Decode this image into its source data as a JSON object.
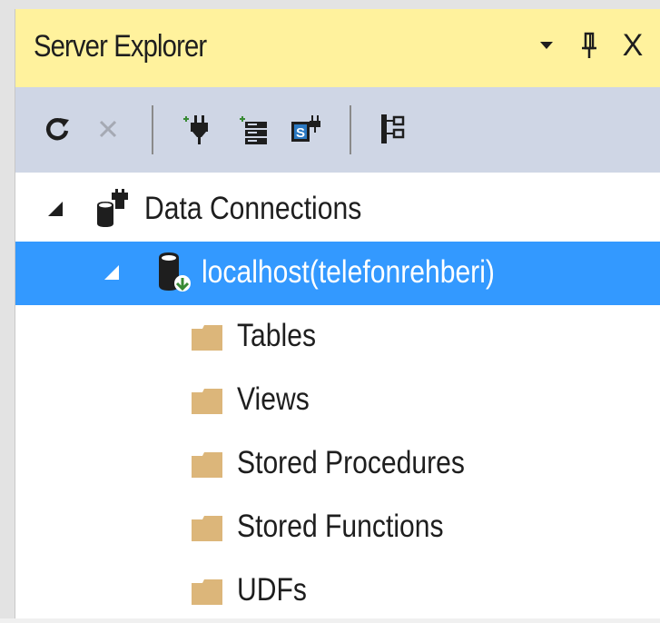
{
  "window": {
    "title": "Server Explorer",
    "dropdown_icon": "triangle-down-icon",
    "pin_icon": "pin-icon",
    "close_glyph": "X"
  },
  "toolbar": {
    "buttons": [
      {
        "name": "refresh",
        "icon": "refresh-icon",
        "enabled": true
      },
      {
        "name": "stop",
        "icon": "close-icon",
        "enabled": false
      },
      {
        "name": "connect-to-database",
        "icon": "plug-add-icon",
        "enabled": true
      },
      {
        "name": "connect-to-server",
        "icon": "server-add-icon",
        "enabled": true
      },
      {
        "name": "connect-to-sharepoint",
        "icon": "sharepoint-icon",
        "enabled": true
      },
      {
        "name": "filter",
        "icon": "tree-view-icon",
        "enabled": true
      }
    ]
  },
  "tree": {
    "root": {
      "label": "Data Connections",
      "expanded": true,
      "icon": "data-connections-icon"
    },
    "connection": {
      "label": "localhost(telefonrehberi)",
      "expanded": true,
      "selected": true,
      "icon": "database-icon"
    },
    "children": [
      {
        "label": "Tables",
        "icon": "folder-icon"
      },
      {
        "label": "Views",
        "icon": "folder-icon"
      },
      {
        "label": "Stored Procedures",
        "icon": "folder-icon"
      },
      {
        "label": "Stored Functions",
        "icon": "folder-icon"
      },
      {
        "label": "UDFs",
        "icon": "folder-icon"
      }
    ]
  },
  "colors": {
    "title_bar": "#fff29d",
    "toolbar": "#cfd6e5",
    "selection": "#3399ff",
    "folder": "#dcb67a"
  }
}
